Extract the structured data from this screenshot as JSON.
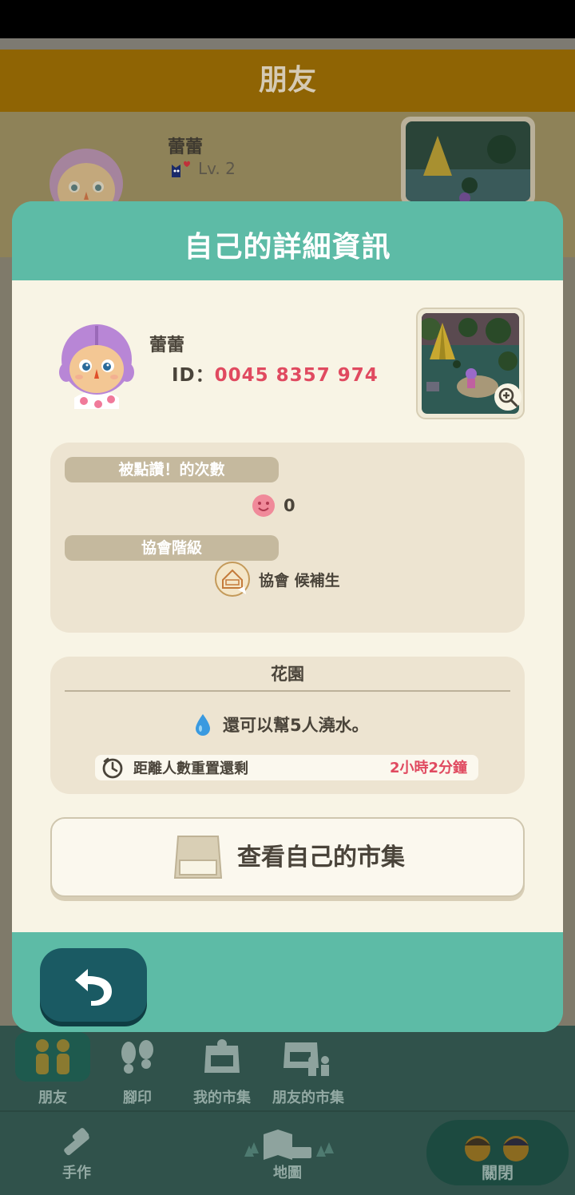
{
  "background_page": {
    "title": "朋友",
    "friend": {
      "name": "蕾蕾",
      "level": "Lv. 2"
    }
  },
  "modal": {
    "title": "自己的詳細資訊",
    "profile": {
      "name": "蕾蕾",
      "id_label": "ID：",
      "id_value": "0045 8357 974"
    },
    "stats": {
      "likes_label": "被點讚！的次數",
      "likes_value": "0",
      "rank_label": "協會階級",
      "rank_value": "協會 候補生"
    },
    "garden": {
      "title": "花園",
      "water_text": "還可以幫5人澆水。",
      "reset_label": "距離人數重置還剩",
      "reset_value": "2小時2分鐘"
    },
    "market_button": "查看自己的市集"
  },
  "bottom_nav": {
    "tabs": [
      {
        "label": "朋友",
        "icon": "friends-icon",
        "active": true
      },
      {
        "label": "腳印",
        "icon": "footprints-icon",
        "active": false
      },
      {
        "label": "我的市集",
        "icon": "market-icon",
        "active": false
      },
      {
        "label": "朋友的市集",
        "icon": "friend-market-icon",
        "active": false
      }
    ],
    "craft_label": "手作",
    "map_label": "地圖",
    "close_label": "關閉"
  },
  "colors": {
    "teal": "#5dbba6",
    "cream": "#f8f4e5",
    "card": "#ede4d1",
    "accent_red": "#e04a60",
    "back_button": "#1a5a63"
  }
}
